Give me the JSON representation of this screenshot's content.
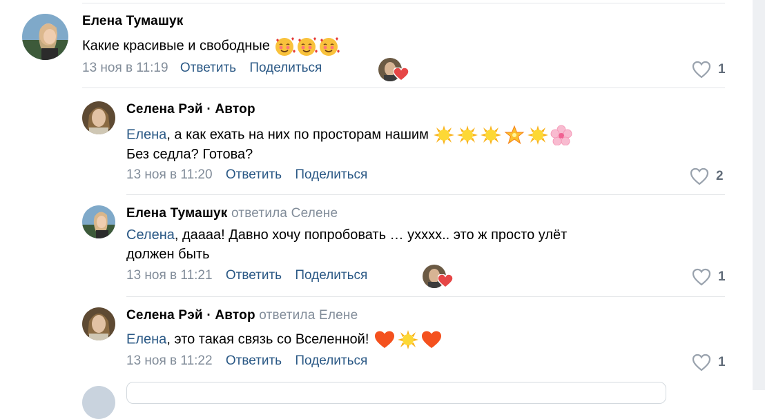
{
  "comments": [
    {
      "author": "Елена Тумашук",
      "replied_to": "",
      "text_main": "Какие красивые и свободные",
      "emojis": [
        "smiling-face-with-hearts",
        "smiling-face-with-hearts",
        "smiling-face-with-hearts"
      ],
      "time": "13 ноя в 11:19",
      "reply_label": "Ответить",
      "share_label": "Поделиться",
      "likes": "1"
    },
    {
      "author": "Селена Рэй · Автор",
      "replied_to": "",
      "mention": "Елена",
      "text_main": ", а как ехать на них по просторам нашим",
      "text_line2": "Без седла? Готова?",
      "emojis": [
        "sun",
        "sun",
        "sun",
        "glowing-star",
        "sun",
        "cherry-blossom"
      ],
      "time": "13 ноя в 11:20",
      "reply_label": "Ответить",
      "share_label": "Поделиться",
      "likes": "2"
    },
    {
      "author": "Елена Тумашук",
      "replied_to": "ответила Селене",
      "mention": "Селена",
      "text_main": ", даааа! Давно хочу попробовать … ухххх.. это ж просто улёт",
      "text_line2": "должен быть",
      "time": "13 ноя в 11:21",
      "reply_label": "Ответить",
      "share_label": "Поделиться",
      "likes": "1"
    },
    {
      "author": "Селена Рэй · Автор",
      "replied_to": "ответила Елене",
      "mention": "Елена",
      "text_main": ", это такая связь со Вселенной!",
      "emojis": [
        "orange-heart",
        "sun",
        "orange-heart"
      ],
      "time": "13 ноя в 11:22",
      "reply_label": "Ответить",
      "share_label": "Поделиться",
      "likes": "1"
    }
  ],
  "colors": {
    "link": "#2a5885",
    "meta": "#818c99",
    "like_heart": "#e64646",
    "divider": "#e3e5e8"
  }
}
